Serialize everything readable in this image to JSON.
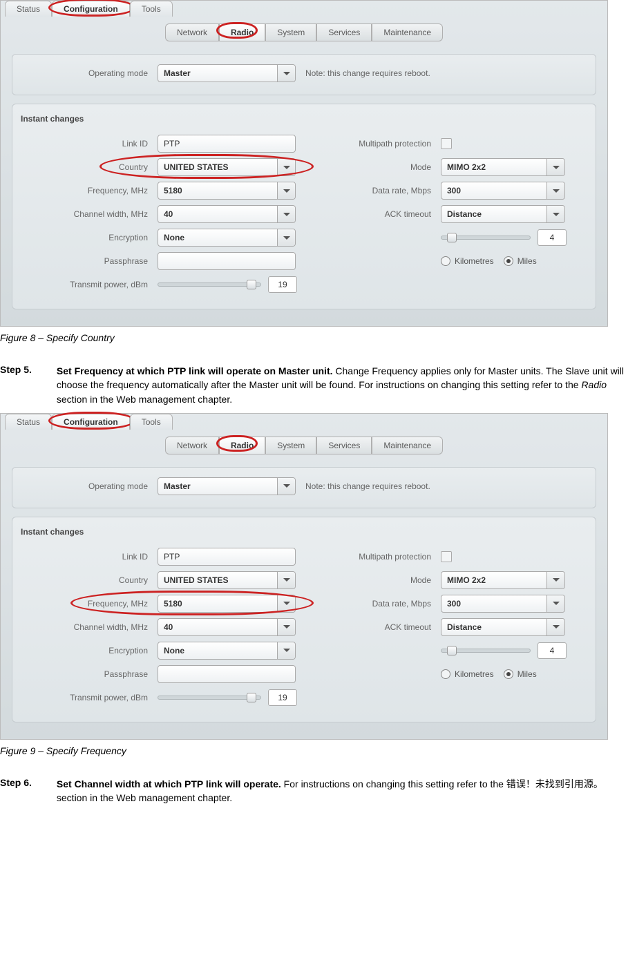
{
  "figure8": {
    "top_tabs": [
      "Status",
      "Configuration",
      "Tools"
    ],
    "top_active": "Configuration",
    "sub_tabs": [
      "Network",
      "Radio",
      "System",
      "Services",
      "Maintenance"
    ],
    "sub_active": "Radio",
    "operating_mode_label": "Operating mode",
    "operating_mode_value": "Master",
    "reboot_note": "Note: this change requires reboot.",
    "instant_header": "Instant changes",
    "left": {
      "link_id_label": "Link ID",
      "link_id_value": "PTP",
      "country_label": "Country",
      "country_value": "UNITED STATES",
      "freq_label": "Frequency, MHz",
      "freq_value": "5180",
      "chanw_label": "Channel width, MHz",
      "chanw_value": "40",
      "enc_label": "Encryption",
      "enc_value": "None",
      "pass_label": "Passphrase",
      "pass_value": "",
      "tx_label": "Transmit power, dBm",
      "tx_value": "19"
    },
    "right": {
      "mp_label": "Multipath protection",
      "mode_label": "Mode",
      "mode_value": "MIMO 2x2",
      "rate_label": "Data rate, Mbps",
      "rate_value": "300",
      "ack_label": "ACK timeout",
      "ack_value": "Distance",
      "dist_value": "4",
      "km_label": "Kilometres",
      "mi_label": "Miles"
    }
  },
  "fig8_caption": "Figure 8 – Specify Country",
  "step5_label": "Step 5.",
  "step5_bold": "Set Frequency at which PTP link will operate on Master unit.",
  "step5_rest_a": " Change Frequency applies only for Master units. The Slave unit will choose the frequency automatically after the Master unit will be found. For instructions on changing this setting refer to the ",
  "step5_ital": "Radio",
  "step5_rest_b": " section in the Web management chapter.",
  "fig9_caption": "Figure 9 – Specify Frequency",
  "step6_label": "Step 6.",
  "step6_bold": "Set Channel width at which PTP link will operate.",
  "step6_rest": " For instructions on changing this setting refer to the 错误！未找到引用源。 section in the Web management chapter."
}
